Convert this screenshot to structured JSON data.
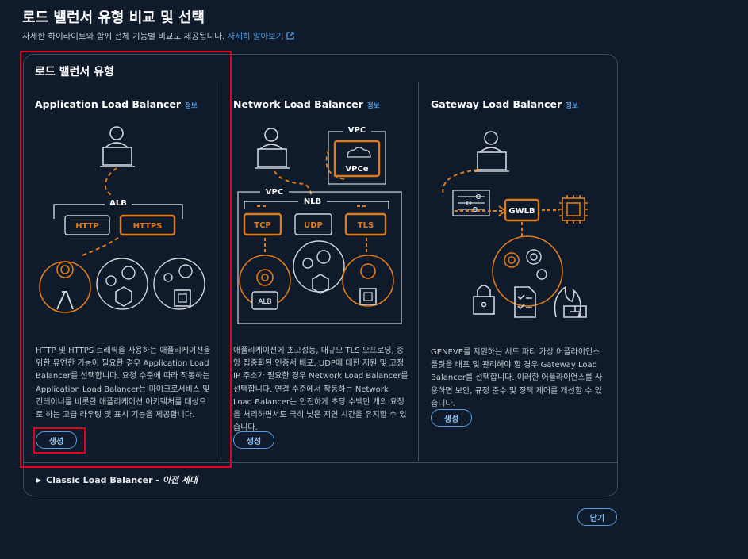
{
  "header": {
    "title": "로드 밸런서 유형 비교 및 선택",
    "subtitle": "자세한 하이라이트와 함께 전체 기능별 비교도 제공됩니다.",
    "link_label": "자세히 알아보기"
  },
  "panel": {
    "title": "로드 밸런서 유형",
    "columns": [
      {
        "title": "Application Load Balancer",
        "info": "정보",
        "description": "HTTP 및 HTTPS 트래픽을 사용하는 애플리케이션을 위한 유연한 기능이 필요한 경우 Application Load Balancer를 선택합니다. 요청 수준에 따라 작동하는 Application Load Balancer는 마이크로서비스 및 컨테이너를 비롯한 애플리케이션 아키텍처를 대상으로 하는 고급 라우팅 및 표시 기능을 제공합니다.",
        "button": "생성",
        "diagram": {
          "group_label": "ALB",
          "listeners": [
            "HTTP",
            "HTTPS"
          ]
        }
      },
      {
        "title": "Network Load Balancer",
        "info": "정보",
        "description": "애플리케이션에 초고성능, 대규모 TLS 오프로딩, 중앙 집중화된 인증서 배포, UDP에 대한 지원 및 고정 IP 주소가 필요한 경우 Network Load Balancer를 선택합니다. 연결 수준에서 작동하는 Network Load Balancer는 안전하게 초당 수백만 개의 요청을 처리하면서도 극히 낮은 지연 시간을 유지할 수 있습니다.",
        "button": "생성",
        "diagram": {
          "vpc_label": "VPC",
          "vpce_label": "VPCe",
          "vpc2_label": "VPC",
          "nlb_label": "NLB",
          "listeners": [
            "TCP",
            "UDP",
            "TLS"
          ],
          "target_label": "ALB"
        }
      },
      {
        "title": "Gateway Load Balancer",
        "info": "정보",
        "description": "GENEVE를 지원하는 서드 파티 가상 어플라이언스 플릿을 배포 및 관리해야 할 경우 Gateway Load Balancer를 선택합니다. 이러한 어플라이언스를 사용하면 보안, 규정 준수 및 정책 제어를 개선할 수 있습니다.",
        "button": "생성",
        "diagram": {
          "gateway_label": "GWLB"
        }
      }
    ],
    "classic": {
      "label": "Classic Load Balancer - ",
      "generation": "이전 세대"
    }
  },
  "footer": {
    "close_button": "닫기"
  },
  "colors": {
    "accent_orange": "#e07b1a",
    "link_blue": "#539fe5",
    "highlight_red": "#e3001b",
    "background": "#0f1b2a",
    "border": "#414d5c"
  }
}
